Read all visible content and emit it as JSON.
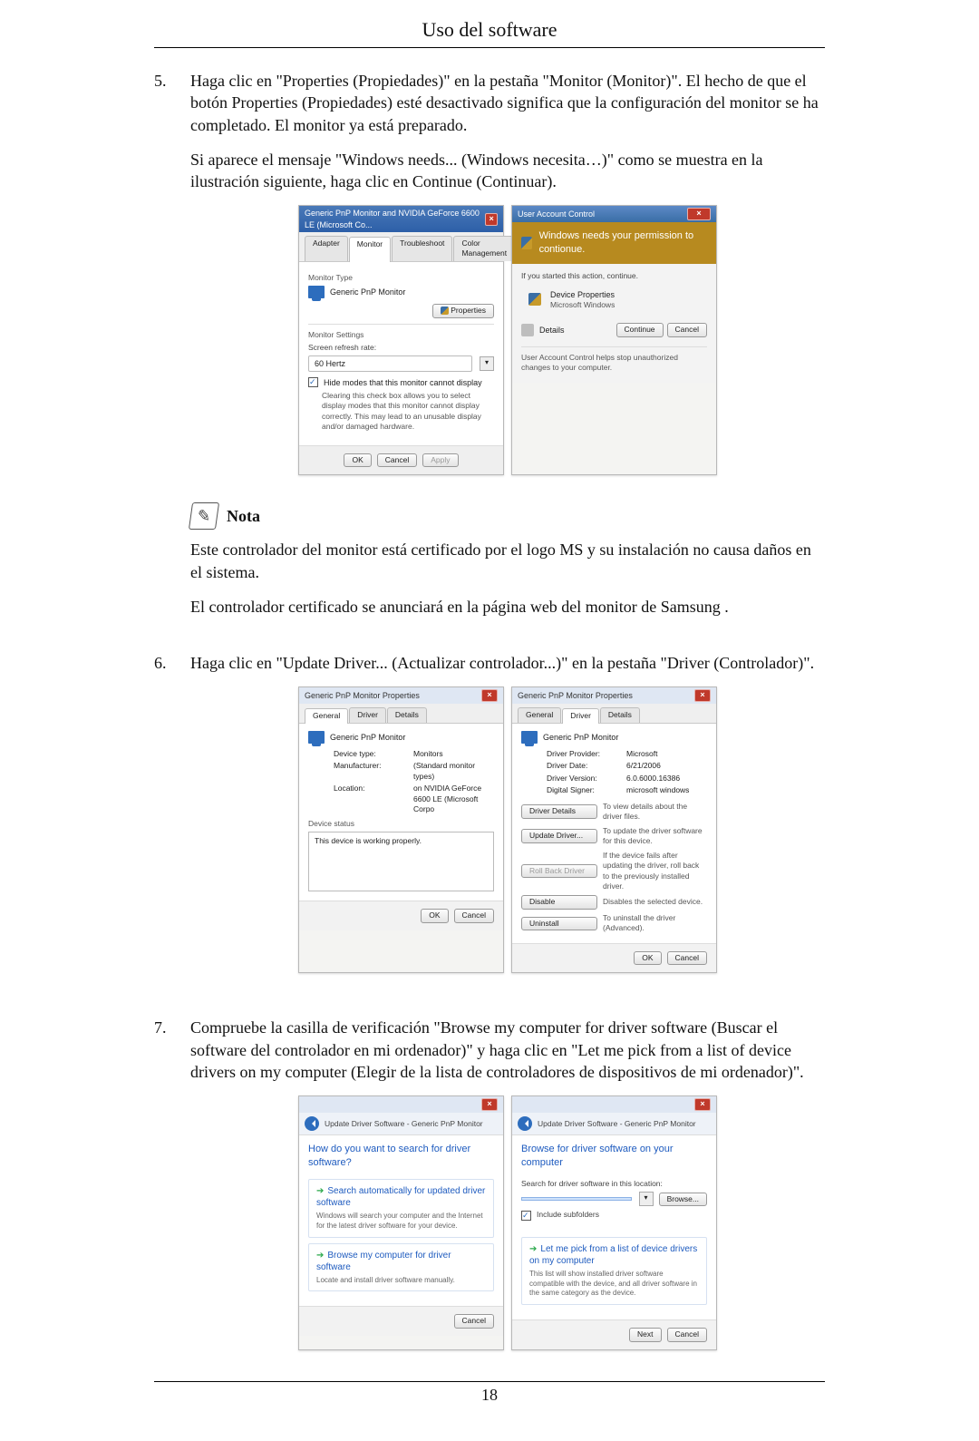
{
  "header_title": "Uso del software",
  "page_number": "18",
  "step5": {
    "num": "5.",
    "para1": "Haga clic en \"Properties (Propiedades)\" en la pestaña \"Monitor (Monitor)\". El hecho de que el botón Properties (Propiedades) esté desactivado significa que la configuración del monitor se ha completado. El monitor ya está preparado.",
    "para2": "Si aparece el mensaje \"Windows needs... (Windows necesita…)\" como se muestra en la ilustración siguiente, haga clic en Continue (Continuar)."
  },
  "step6": {
    "num": "6.",
    "para": "Haga clic en \"Update Driver... (Actualizar controlador...)\" en la pestaña \"Driver (Controlador)\"."
  },
  "step7": {
    "num": "7.",
    "para": "Compruebe la casilla de verificación \"Browse my computer for driver software (Buscar el software del controlador en mi ordenador)\" y haga clic en \"Let me pick from a list of device drivers on my computer (Elegir de la lista de controladores de dispositivos de mi ordenador)\"."
  },
  "note": {
    "label": "Nota",
    "p1": "Este controlador del monitor está certificado por el logo MS y su instalación no causa daños en el sistema.",
    "p2": "El controlador certificado se anunciará en la página web del monitor de Samsung ."
  },
  "winA": {
    "title": "Generic PnP Monitor and NVIDIA GeForce 6600 LE (Microsoft Co...",
    "tabs": {
      "adapter": "Adapter",
      "monitor": "Monitor",
      "troubleshoot": "Troubleshoot",
      "color": "Color Management"
    },
    "monitor_type_label": "Monitor Type",
    "monitor_type_value": "Generic PnP Monitor",
    "properties_btn": "Properties",
    "monitor_settings_label": "Monitor Settings",
    "refresh_label": "Screen refresh rate:",
    "refresh_value": "60 Hertz",
    "hide_modes": "Hide modes that this monitor cannot display",
    "hide_modes_desc": "Clearing this check box allows you to select display modes that this monitor cannot display correctly. This may lead to an unusable display and/or damaged hardware.",
    "ok": "OK",
    "cancel": "Cancel",
    "apply": "Apply"
  },
  "uac": {
    "title": "User Account Control",
    "banner": "Windows needs your permission to contionue.",
    "line1": "If you started this action, continue.",
    "app": "Device Properties",
    "pub": "Microsoft Windows",
    "details": "Details",
    "continue": "Continue",
    "cancel": "Cancel",
    "footer": "User Account Control helps stop unauthorized changes to your computer."
  },
  "propsGeneral": {
    "title": "Generic PnP Monitor Properties",
    "tabs": {
      "general": "General",
      "driver": "Driver",
      "details": "Details"
    },
    "name": "Generic PnP Monitor",
    "kv": {
      "device_type_l": "Device type:",
      "device_type_v": "Monitors",
      "manufacturer_l": "Manufacturer:",
      "manufacturer_v": "(Standard monitor types)",
      "location_l": "Location:",
      "location_v": "on NVIDIA GeForce 6600 LE (Microsoft Corpo"
    },
    "device_status_l": "Device status",
    "device_status_v": "This device is working properly.",
    "ok": "OK",
    "cancel": "Cancel"
  },
  "propsDriver": {
    "title": "Generic PnP Monitor Properties",
    "name": "Generic PnP Monitor",
    "kv": {
      "provider_l": "Driver Provider:",
      "provider_v": "Microsoft",
      "date_l": "Driver Date:",
      "date_v": "6/21/2006",
      "version_l": "Driver Version:",
      "version_v": "6.0.6000.16386",
      "signer_l": "Digital Signer:",
      "signer_v": "microsoft windows"
    },
    "btns": {
      "details": "Driver Details",
      "details_d": "To view details about the driver files.",
      "update": "Update Driver...",
      "update_d": "To update the driver software for this device.",
      "rollback": "Roll Back Driver",
      "rollback_d": "If the device fails after updating the driver, roll back to the previously installed driver.",
      "disable": "Disable",
      "disable_d": "Disables the selected device.",
      "uninstall": "Uninstall",
      "uninstall_d": "To uninstall the driver (Advanced)."
    },
    "ok": "OK",
    "cancel": "Cancel"
  },
  "wizard1": {
    "crumb": "Update Driver Software - Generic PnP Monitor",
    "heading": "How do you want to search for driver software?",
    "optA_t": "Search automatically for updated driver software",
    "optA_s": "Windows will search your computer and the Internet for the latest driver software for your device.",
    "optB_t": "Browse my computer for driver software",
    "optB_s": "Locate and install driver software manually.",
    "cancel": "Cancel"
  },
  "wizard2": {
    "crumb": "Update Driver Software - Generic PnP Monitor",
    "heading": "Browse for driver software on your computer",
    "path_label": "Search for driver software in this location:",
    "path_value": "",
    "browse": "Browse...",
    "include_sub": "Include subfolders",
    "pick_t": "Let me pick from a list of device drivers on my computer",
    "pick_s": "This list will show installed driver software compatible with the device, and all driver software in the same category as the device.",
    "next": "Next",
    "cancel": "Cancel"
  }
}
